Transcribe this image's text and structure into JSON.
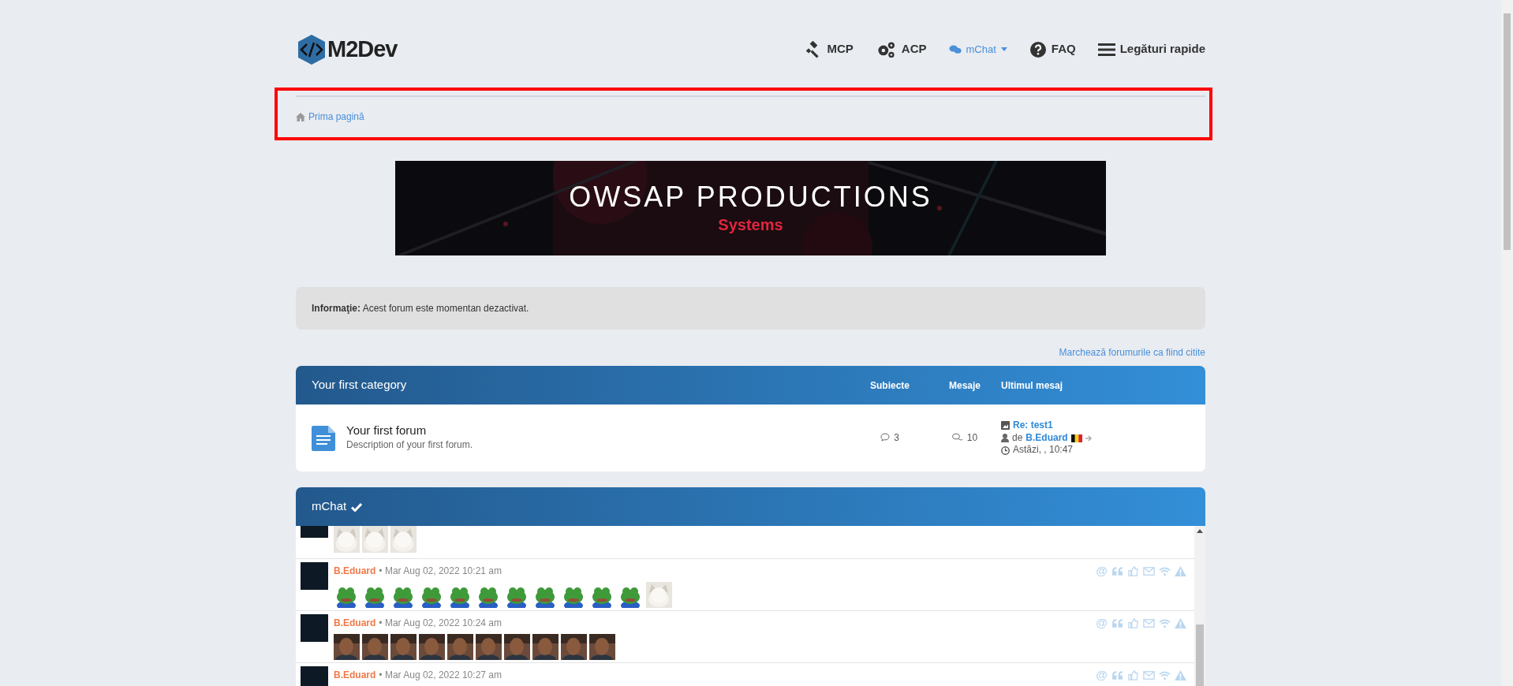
{
  "logo": {
    "text": "M2Dev"
  },
  "nav": [
    {
      "kind": "gavel",
      "label": "MCP",
      "dropdown": false
    },
    {
      "kind": "gears",
      "label": "ACP",
      "dropdown": false
    },
    {
      "kind": "chat",
      "label": "mChat",
      "dropdown": true
    },
    {
      "kind": "question",
      "label": "FAQ",
      "dropdown": false
    },
    {
      "kind": "menu",
      "label": "Legături rapide",
      "dropdown": false
    }
  ],
  "breadcrumb": {
    "label": "Prima pagină",
    "highlighted": true
  },
  "banner": {
    "title": "OWSAP PRODUCTIONS",
    "subtitle": "Systems"
  },
  "notice": "**Informaţie:** Acest forum este momentan dezactivat.",
  "mark_read": "Marchează forumurile ca fiind citite",
  "category": {
    "title": "Your first category",
    "columns": [
      "Subiecte",
      "Mesaje",
      "Ultimul mesaj"
    ],
    "forums": [
      {
        "name": "Your first forum",
        "description": "Description of your first forum.",
        "topics": "3",
        "posts": "10",
        "last_post": {
          "title": "Re: test1",
          "by": "de",
          "author": "B.Eduard",
          "time": "Astăzi, , 10:47"
        }
      }
    ]
  },
  "chat": {
    "title": "mChat",
    "messages": [
      {
        "stickers": [
          {
            "kind": "cat"
          },
          {
            "kind": "cat"
          },
          {
            "kind": "cat"
          }
        ]
      },
      {
        "author": "B.Eduard",
        "time": "• Mar Aug 02, 2022 10:21 am",
        "mention": "@",
        "stickers": [
          {
            "kind": "frog"
          },
          {
            "kind": "frog"
          },
          {
            "kind": "frog"
          },
          {
            "kind": "frog"
          },
          {
            "kind": "frog"
          },
          {
            "kind": "frog"
          },
          {
            "kind": "frog"
          },
          {
            "kind": "frog"
          },
          {
            "kind": "frog"
          },
          {
            "kind": "frog"
          },
          {
            "kind": "frog"
          },
          {
            "kind": "cat"
          }
        ]
      },
      {
        "author": "B.Eduard",
        "time": "• Mar Aug 02, 2022 10:24 am",
        "mention": "@",
        "stickers": [
          {
            "kind": "person"
          },
          {
            "kind": "person"
          },
          {
            "kind": "person"
          },
          {
            "kind": "person"
          },
          {
            "kind": "person"
          },
          {
            "kind": "person"
          },
          {
            "kind": "person"
          },
          {
            "kind": "person"
          },
          {
            "kind": "person"
          },
          {
            "kind": "person"
          }
        ]
      },
      {
        "author": "B.Eduard",
        "time": "• Mar Aug 02, 2022 10:27 am",
        "mention": "@"
      }
    ]
  }
}
